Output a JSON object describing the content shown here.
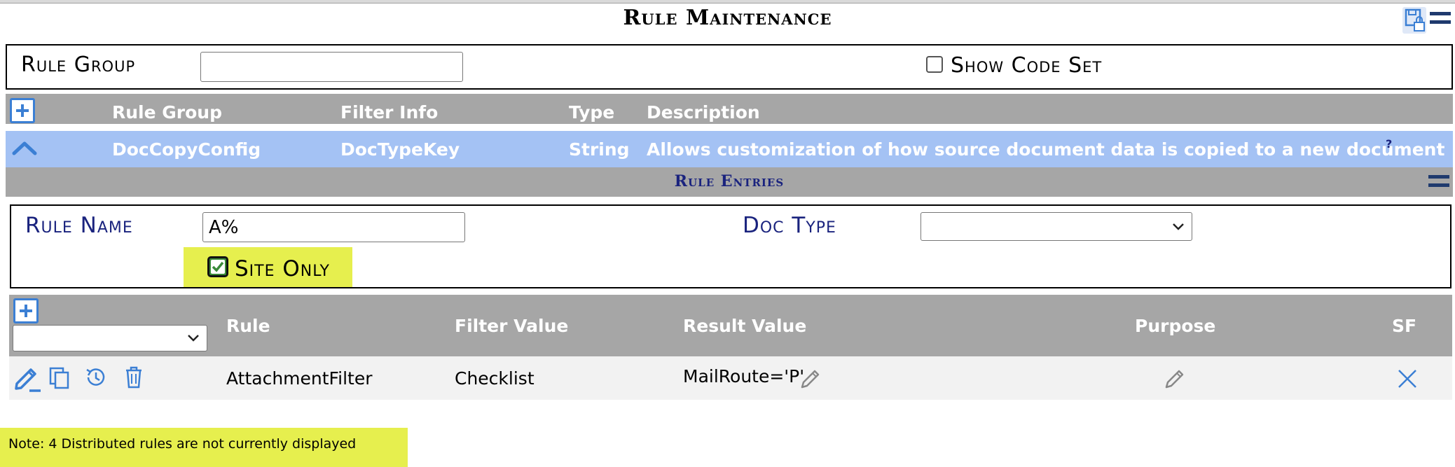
{
  "page": {
    "title": "Rule Maintenance"
  },
  "filter": {
    "rule_group_label": "Rule Group",
    "rule_group_value": "",
    "show_code_set_label": "Show Code Set",
    "show_code_set_checked": false
  },
  "groups_table": {
    "columns": [
      "Rule Group",
      "Filter Info",
      "Type",
      "Description"
    ],
    "selected_row": {
      "rule_group": "DocCopyConfig",
      "filter_info": "DocTypeKey",
      "type": "String",
      "description": "Allows customization of how source document data is copied to a new document",
      "help_marker": "?"
    }
  },
  "rule_entries": {
    "title": "Rule Entries",
    "rule_name_label": "Rule Name",
    "rule_name_value": "A%",
    "doc_type_label": "Doc Type",
    "doc_type_value": "",
    "site_only_label": "Site Only",
    "site_only_checked": true
  },
  "rules_table": {
    "columns": [
      "Rule",
      "Filter Value",
      "Result Value",
      "Purpose",
      "SF"
    ],
    "rows": [
      {
        "rule": "AttachmentFilter",
        "filter_value": "Checklist",
        "result_value": "MailRoute='P'"
      }
    ]
  },
  "note": "Note: 4 Distributed rules are not currently displayed",
  "icons": [
    "save-lock-icon",
    "menu-icon",
    "add-icon",
    "collapse-icon",
    "edit-icon",
    "copy-icon",
    "history-icon",
    "delete-icon",
    "pencil-icon",
    "close-icon"
  ],
  "colors": {
    "accent": "#3b7fd4",
    "header_grey": "#a6a6a6",
    "selected_row": "#a4c2f4",
    "highlight": "#e6ef4e",
    "navy": "#1a237e"
  }
}
